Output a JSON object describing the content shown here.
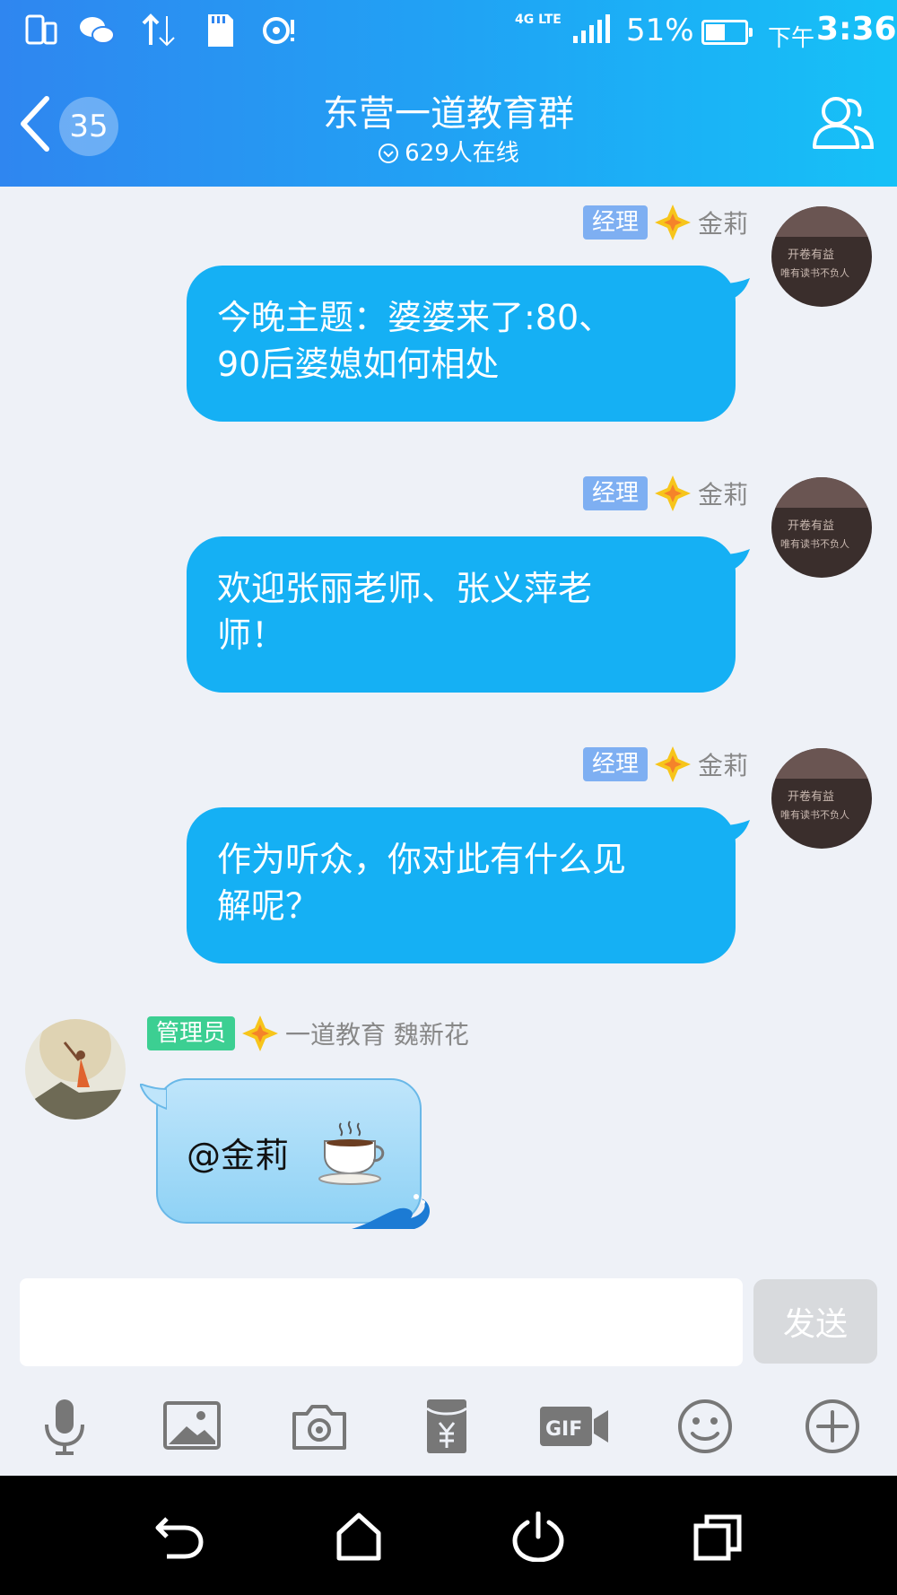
{
  "status_bar": {
    "network": "4G LTE",
    "battery_percent": "51%",
    "battery_level": 0.51,
    "time_prefix": "下午",
    "time": "3:36"
  },
  "header": {
    "unread_count": "35",
    "title": "东营一道教育群",
    "online": "629人在线"
  },
  "messages": [
    {
      "role": "经理",
      "sender": "金莉",
      "text_line1": "今晚主题：婆婆来了:80、",
      "text_line2": "90后婆媳如何相处"
    },
    {
      "role": "经理",
      "sender": "金莉",
      "text_line1": "欢迎张丽老师、张义萍老",
      "text_line2": "师！"
    },
    {
      "role": "经理",
      "sender": "金莉",
      "text_line1": "作为听众，你对此有什么见",
      "text_line2": "解呢？"
    },
    {
      "role": "管理员",
      "sender": "一道教育 魏新花",
      "text": "@金莉"
    }
  ],
  "avatar_text": {
    "line1": "开卷有益",
    "line2": "唯有读书不负人"
  },
  "input": {
    "placeholder": "",
    "send_label": "发送"
  },
  "colors": {
    "header_start": "#2f86f0",
    "header_end": "#16c1f7",
    "bubble": "#15b0f4",
    "role_manager": "#7eaff2",
    "role_admin": "#3ccf92"
  },
  "icons": {
    "toolbar": [
      "microphone-icon",
      "image-icon",
      "camera-icon",
      "red-packet-icon",
      "gif-icon",
      "emoji-icon",
      "plus-icon"
    ],
    "navigation": [
      "back-nav-icon",
      "home-nav-icon",
      "power-nav-icon",
      "recents-nav-icon"
    ]
  }
}
